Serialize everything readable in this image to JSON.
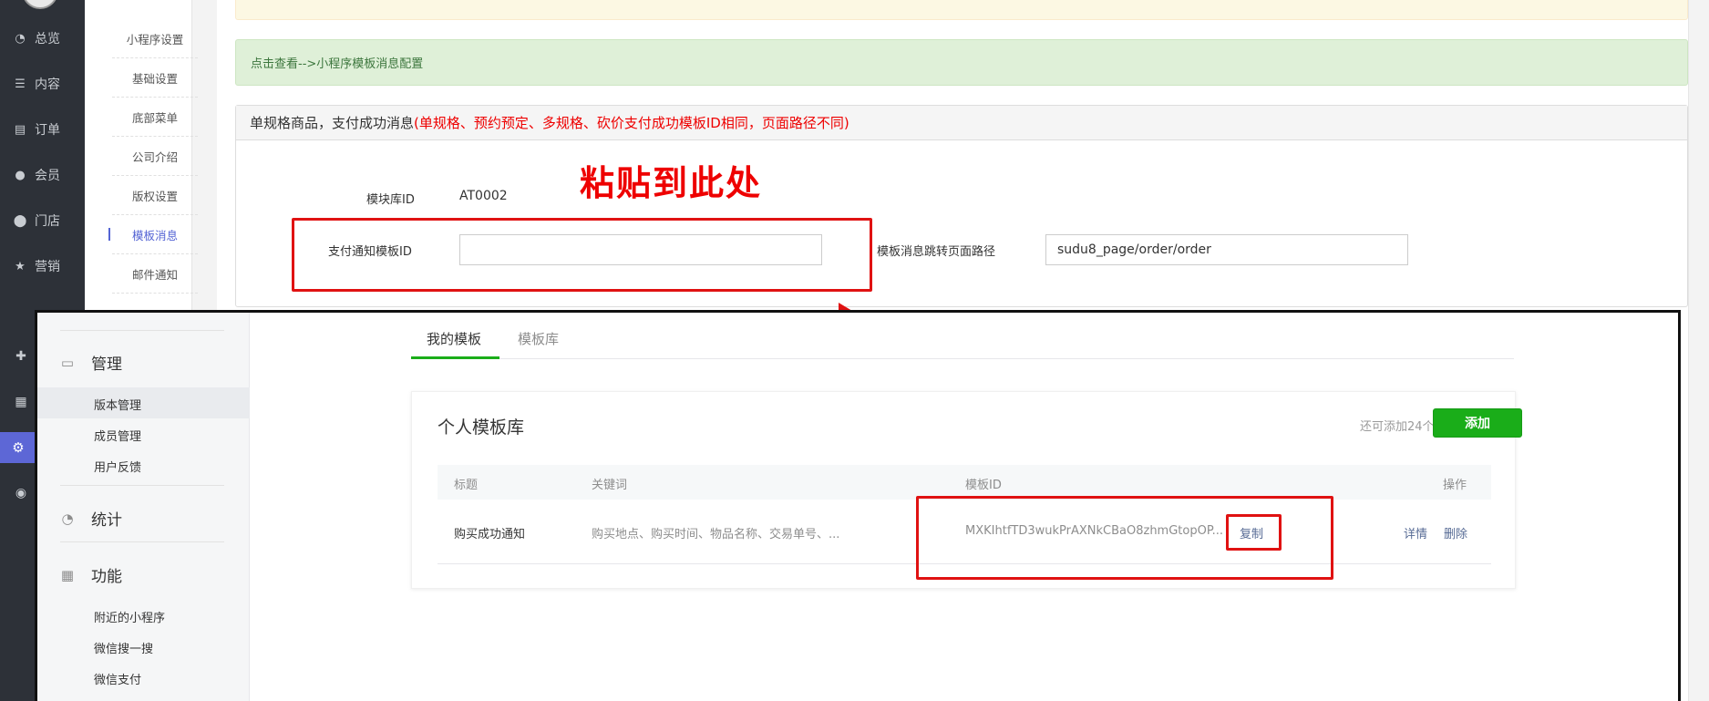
{
  "admin": {
    "nav": [
      {
        "icon": "pie-chart-icon",
        "glyph": "◔",
        "label": "总览"
      },
      {
        "icon": "list-icon",
        "glyph": "☰",
        "label": "内容"
      },
      {
        "icon": "document-icon",
        "glyph": "▤",
        "label": "订单"
      },
      {
        "icon": "user-icon",
        "glyph": "●",
        "label": "会员"
      },
      {
        "icon": "location-pin-icon",
        "glyph": "⬤",
        "label": "门店"
      },
      {
        "icon": "star-icon",
        "glyph": "★",
        "label": "营销"
      }
    ],
    "subnav": [
      "小程序设置",
      "基础设置",
      "底部菜单",
      "公司介绍",
      "版权设置",
      "模板消息",
      "邮件通知"
    ],
    "link_bar": "点击查看-->小程序模板消息配置",
    "panel": {
      "title": "单规格商品，支付成功消息",
      "title_note": "(单规格、预约预定、多规格、砍价支付成功模板ID相同，页面路径不同)",
      "library_id_label": "模块库ID",
      "library_id_value": "AT0002",
      "template_id_label": "支付通知模板ID",
      "template_id_value": "",
      "path_label": "模板消息跳转页面路径",
      "path_value": "sudu8_page/order/order"
    },
    "callout": "粘贴到此处"
  },
  "wx": {
    "side": {
      "manage": "管理",
      "manage_links": [
        "版本管理",
        "成员管理",
        "用户反馈"
      ],
      "stats": "统计",
      "features": "功能",
      "feature_links": [
        "附近的小程序",
        "微信搜一搜",
        "微信支付"
      ]
    },
    "tabs": [
      "我的模板",
      "模板库"
    ],
    "card": {
      "title": "个人模板库",
      "quota": "还可添加24个",
      "add_label": "添加",
      "headers": {
        "title": "标题",
        "keywords": "关键词",
        "template_id": "模板ID",
        "actions": "操作"
      },
      "row": {
        "title": "购买成功通知",
        "keywords": "购买地点、购买时间、物品名称、交易单号、...",
        "template_id": "MXKIhtfTD3wukPrAXNkCBaO8zhmGtopOP...",
        "copy": "复制",
        "detail": "详情",
        "delete": "删除"
      }
    }
  },
  "colors": {
    "accent_red": "#e01212",
    "wx_green": "#1aad19",
    "admin_nav": "#2d3138",
    "admin_accent": "#5d67d6"
  }
}
